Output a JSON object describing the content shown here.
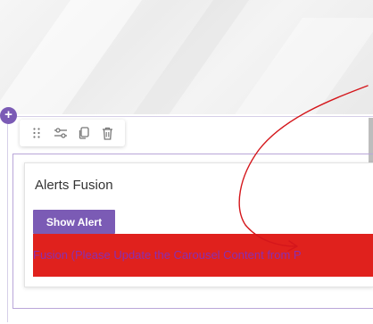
{
  "builder": {
    "add_section_symbol": "+"
  },
  "toolbar": {
    "icons": [
      "drag-handle-icon",
      "settings-sliders-icon",
      "copy-icon",
      "trash-icon"
    ]
  },
  "alerts_card": {
    "title": "Alerts Fusion",
    "button_label": "Show Alert",
    "banner_text": "Fusion (Please Update the Carousel Content from P"
  },
  "colors": {
    "accent_purple": "#7b5bb5",
    "banner_red": "#e0211d",
    "banner_text": "#8a2fb0",
    "annotation_red": "#d4161b"
  }
}
